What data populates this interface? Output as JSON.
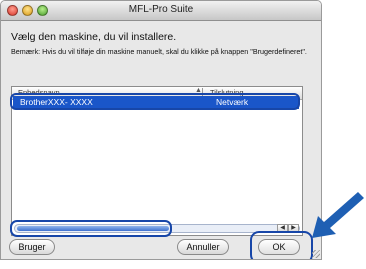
{
  "window": {
    "title": "MFL-Pro Suite"
  },
  "heading": "Vælg den maskine, du vil installere.",
  "note": "Bemærk: Hvis du vil tilføje din maskine manuelt, skal du klikke på knappen \"Brugerdefineret\".",
  "table": {
    "columns": [
      "Enhedsnavn",
      "Tilslutning"
    ],
    "rows": [
      {
        "name": "BrotherXXX- XXXX",
        "connection": "Netværk",
        "selected": true
      }
    ]
  },
  "buttons": {
    "custom": "Bruger",
    "cancel": "Annuller",
    "ok": "OK"
  },
  "colors": {
    "selection": "#1a56c9",
    "highlight_outline": "#1746a8",
    "arrow": "#1e5fb3"
  },
  "icons": {
    "close": "close-icon",
    "minimize": "minimize-icon",
    "zoom": "zoom-icon",
    "pointer": "pointer-arrow-icon"
  }
}
